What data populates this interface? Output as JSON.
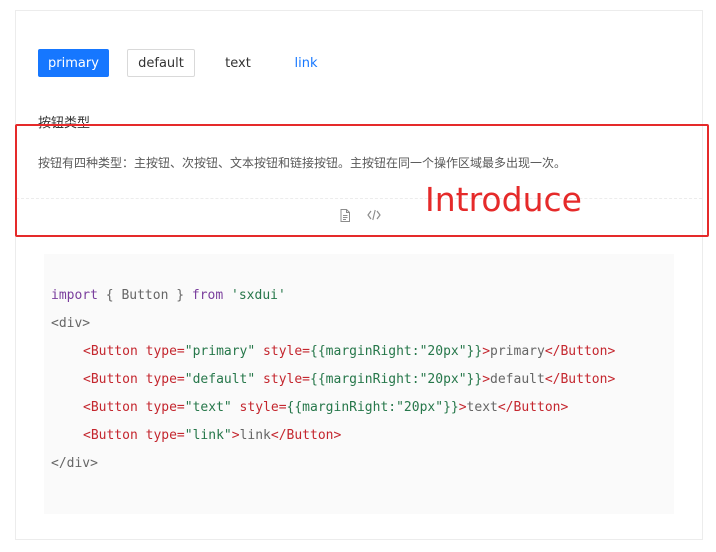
{
  "buttons": {
    "primary": "primary",
    "default": "default",
    "text": "text",
    "link": "link"
  },
  "demo": {
    "title": "按钮类型",
    "description": "按钮有四种类型：主按钮、次按钮、文本按钮和链接按钮。主按钮在同一个操作区域最多出现一次。"
  },
  "actions": {
    "doc_icon": "file-icon",
    "code_icon": "code-icon"
  },
  "annotation": {
    "label": "Introduce",
    "color": "#e52a2a"
  },
  "code": {
    "line1": {
      "kw1": "import",
      "mid": " { Button } ",
      "kw2": "from",
      "sp": " ",
      "str": "'sxdui'"
    },
    "line2": "<div>",
    "line3": {
      "open": "<Button",
      "attr1": " type=",
      "v1": "\"primary\"",
      "attr2": " style=",
      "v2": "{{marginRight:\"20px\"}}",
      "gt": ">",
      "txt": "primary",
      "close": "</Button>"
    },
    "line4": {
      "open": "<Button",
      "attr1": " type=",
      "v1": "\"default\"",
      "attr2": " style=",
      "v2": "{{marginRight:\"20px\"}}",
      "gt": ">",
      "txt": "default",
      "close": "</Button>"
    },
    "line5": {
      "open": "<Button",
      "attr1": " type=",
      "v1": "\"text\"",
      "attr2": " style=",
      "v2": "{{marginRight:\"20px\"}}",
      "gt": ">",
      "txt": "text",
      "close": "</Button>"
    },
    "line6": {
      "open": "<Button",
      "attr1": " type=",
      "v1": "\"link\"",
      "gt": ">",
      "txt": "link",
      "close": "</Button>"
    },
    "line7": "</div>"
  },
  "colors": {
    "primary": "#1677ff",
    "annotation": "#e52a2a"
  }
}
